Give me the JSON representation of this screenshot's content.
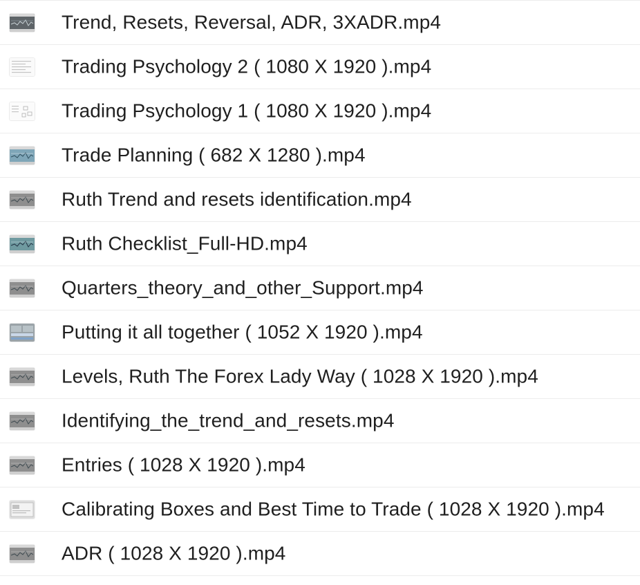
{
  "files": [
    {
      "name": "Trend, Resets, Reversal, ADR, 3XADR.mp4",
      "thumbnail_icon": "chart-video-thumbnail-icon",
      "thumb_variant": "dark-chart"
    },
    {
      "name": "Trading Psychology 2 ( 1080 X 1920 ).mp4",
      "thumbnail_icon": "document-video-thumbnail-icon",
      "thumb_variant": "doc-lines"
    },
    {
      "name": "Trading Psychology 1 ( 1080 X 1920 ).mp4",
      "thumbnail_icon": "diagram-video-thumbnail-icon",
      "thumb_variant": "doc-diagram"
    },
    {
      "name": "Trade Planning ( 682 X 1280 ).mp4",
      "thumbnail_icon": "chart-video-thumbnail-icon",
      "thumb_variant": "blue-chart"
    },
    {
      "name": "Ruth Trend and resets identification.mp4",
      "thumbnail_icon": "chart-video-thumbnail-icon",
      "thumb_variant": "gray-chart"
    },
    {
      "name": "Ruth Checklist_Full-HD.mp4",
      "thumbnail_icon": "chart-video-thumbnail-icon",
      "thumb_variant": "teal-chart"
    },
    {
      "name": "Quarters_theory_and_other_Support.mp4",
      "thumbnail_icon": "chart-video-thumbnail-icon",
      "thumb_variant": "gray-chart"
    },
    {
      "name": "Putting it all together ( 1052 X 1920 ).mp4",
      "thumbnail_icon": "chart-video-thumbnail-icon",
      "thumb_variant": "multi-chart"
    },
    {
      "name": "Levels, Ruth The Forex Lady Way ( 1028 X 1920 ).mp4",
      "thumbnail_icon": "chart-video-thumbnail-icon",
      "thumb_variant": "gray-chart"
    },
    {
      "name": "Identifying_the_trend_and_resets.mp4",
      "thumbnail_icon": "chart-video-thumbnail-icon",
      "thumb_variant": "gray-chart"
    },
    {
      "name": "Entries ( 1028 X 1920 ).mp4",
      "thumbnail_icon": "chart-video-thumbnail-icon",
      "thumb_variant": "gray-chart"
    },
    {
      "name": "Calibrating Boxes and Best Time to Trade ( 1028 X 1920 ).mp4",
      "thumbnail_icon": "chart-video-thumbnail-icon",
      "thumb_variant": "light-window"
    },
    {
      "name": "ADR ( 1028 X 1920 ).mp4",
      "thumbnail_icon": "chart-video-thumbnail-icon",
      "thumb_variant": "gray-chart"
    }
  ],
  "colors": {
    "text": "#1f1f1f",
    "divider": "#ececec",
    "background": "#ffffff",
    "thumb_gray": "#8e8e8e",
    "thumb_dark": "#5e6468",
    "thumb_teal": "#6f9aa0",
    "thumb_blue": "#7fa6b8"
  }
}
